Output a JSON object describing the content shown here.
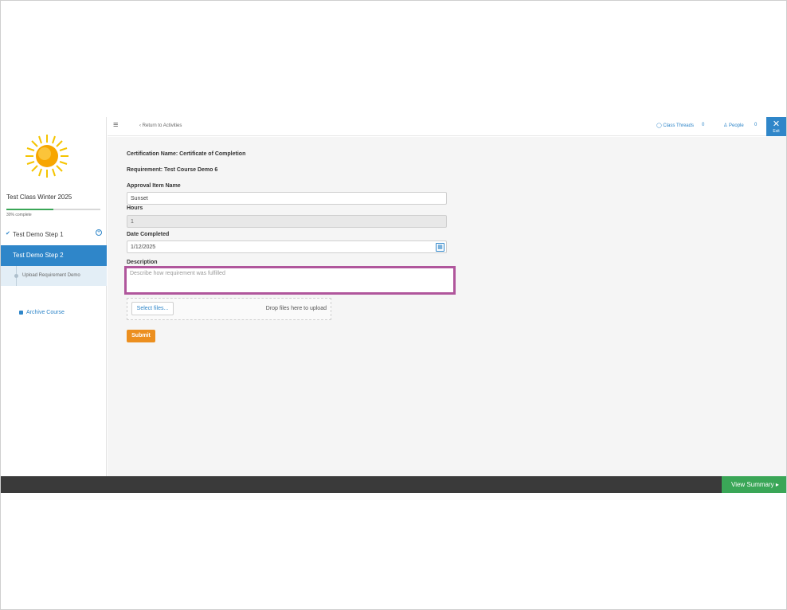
{
  "sidebar": {
    "course_title": "Test Class Winter 2025",
    "progress_text": "30% complete",
    "progress_fraction": 0.5,
    "step1_label": "Test Demo Step 1",
    "step2_label": "Test Demo Step 2",
    "substep_label": "Upload Requirement Demo",
    "archive_label": "Archive Course"
  },
  "topbar": {
    "return_label": "Return to Activities",
    "threads_label": "Class Threads",
    "threads_count": "0",
    "people_label": "People",
    "people_count": "0",
    "exit_label": "Exit"
  },
  "form": {
    "certification": "Certification Name: Certificate of Completion",
    "requirement": "Requirement: Test Course Demo 6",
    "approval_label": "Approval Item Name",
    "approval_value": "Sunset",
    "hours_label": "Hours",
    "hours_value": "1",
    "date_label": "Date Completed",
    "date_value": "1/12/2025",
    "description_label": "Description",
    "description_placeholder": "Describe how requirement was fulfilled",
    "select_files_label": "Select files...",
    "drop_text": "Drop files here to upload",
    "submit_label": "Submit"
  },
  "footer": {
    "view_summary_label": "View Summary"
  },
  "colors": {
    "accent": "#2f86c9",
    "highlight": "#b0569c",
    "submit": "#ec8f1f",
    "summary": "#3aa657"
  }
}
